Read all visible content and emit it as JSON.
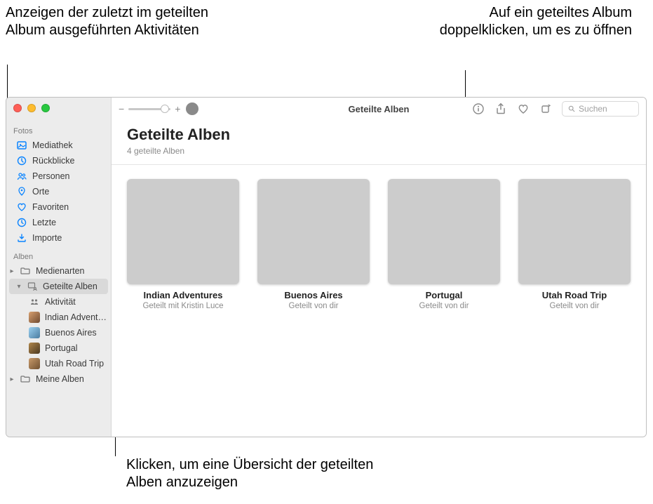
{
  "callouts": {
    "top_left": "Anzeigen der zuletzt im geteilten Album ausgeführten Aktivitäten",
    "top_right": "Auf ein geteiltes Album doppelklicken, um es zu öffnen",
    "bottom": "Klicken, um eine Übersicht der geteilten Alben anzuzeigen"
  },
  "toolbar": {
    "title": "Geteilte Alben",
    "search_placeholder": "Suchen"
  },
  "header": {
    "title": "Geteilte Alben",
    "subtitle": "4 geteilte Alben"
  },
  "sidebar": {
    "section_fotos": "Fotos",
    "section_alben": "Alben",
    "mediathek": "Mediathek",
    "rueckblicke": "Rückblicke",
    "personen": "Personen",
    "orte": "Orte",
    "favoriten": "Favoriten",
    "letzte": "Letzte",
    "importe": "Importe",
    "medienarten": "Medienarten",
    "geteilte_alben": "Geteilte Alben",
    "aktivitaet": "Aktivität",
    "indian": "Indian Advent…",
    "buenos": "Buenos Aires",
    "portugal": "Portugal",
    "utah": "Utah Road Trip",
    "meine_alben": "Meine Alben"
  },
  "albums": [
    {
      "title": "Indian Adventures",
      "meta": "Geteilt mit Kristin Luce"
    },
    {
      "title": "Buenos Aires",
      "meta": "Geteilt von dir"
    },
    {
      "title": "Portugal",
      "meta": "Geteilt von dir"
    },
    {
      "title": "Utah Road Trip",
      "meta": "Geteilt von dir"
    }
  ]
}
